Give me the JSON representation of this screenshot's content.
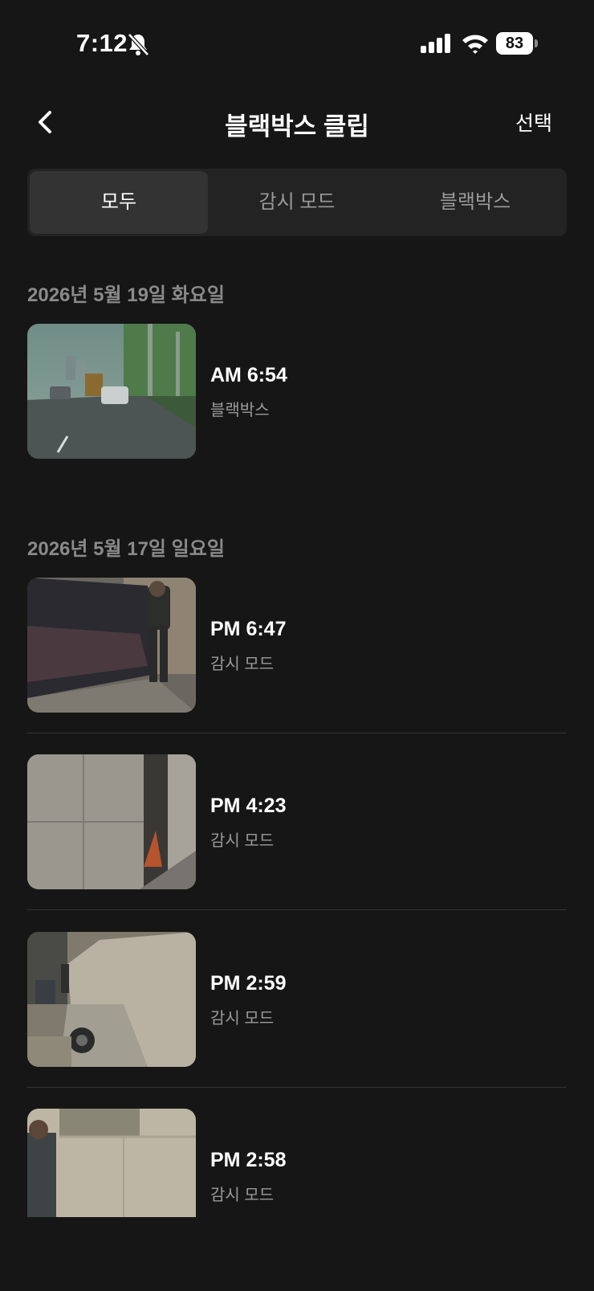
{
  "status_bar": {
    "time": "7:12",
    "battery": "83"
  },
  "header": {
    "title": "블랙박스 클립",
    "select_label": "선택"
  },
  "tabs": [
    {
      "label": "모두",
      "active": true
    },
    {
      "label": "감시 모드",
      "active": false
    },
    {
      "label": "블랙박스",
      "active": false
    }
  ],
  "groups": [
    {
      "date": "2026년 5월 19일 화요일",
      "clips": [
        {
          "time": "AM 6:54",
          "type": "블랙박스",
          "thumb": "road"
        }
      ]
    },
    {
      "date": "2026년 5월 17일 일요일",
      "clips": [
        {
          "time": "PM 6:47",
          "type": "감시 모드",
          "thumb": "car-side-person"
        },
        {
          "time": "PM 4:23",
          "type": "감시 모드",
          "thumb": "wall-cone"
        },
        {
          "time": "PM 2:59",
          "type": "감시 모드",
          "thumb": "white-car"
        },
        {
          "time": "PM 2:58",
          "type": "감시 모드",
          "thumb": "wall-person"
        }
      ]
    }
  ],
  "colors": {
    "background": "#161616",
    "segment_bg": "#232323",
    "segment_active": "#333333",
    "muted_text": "#9a9a9a"
  }
}
